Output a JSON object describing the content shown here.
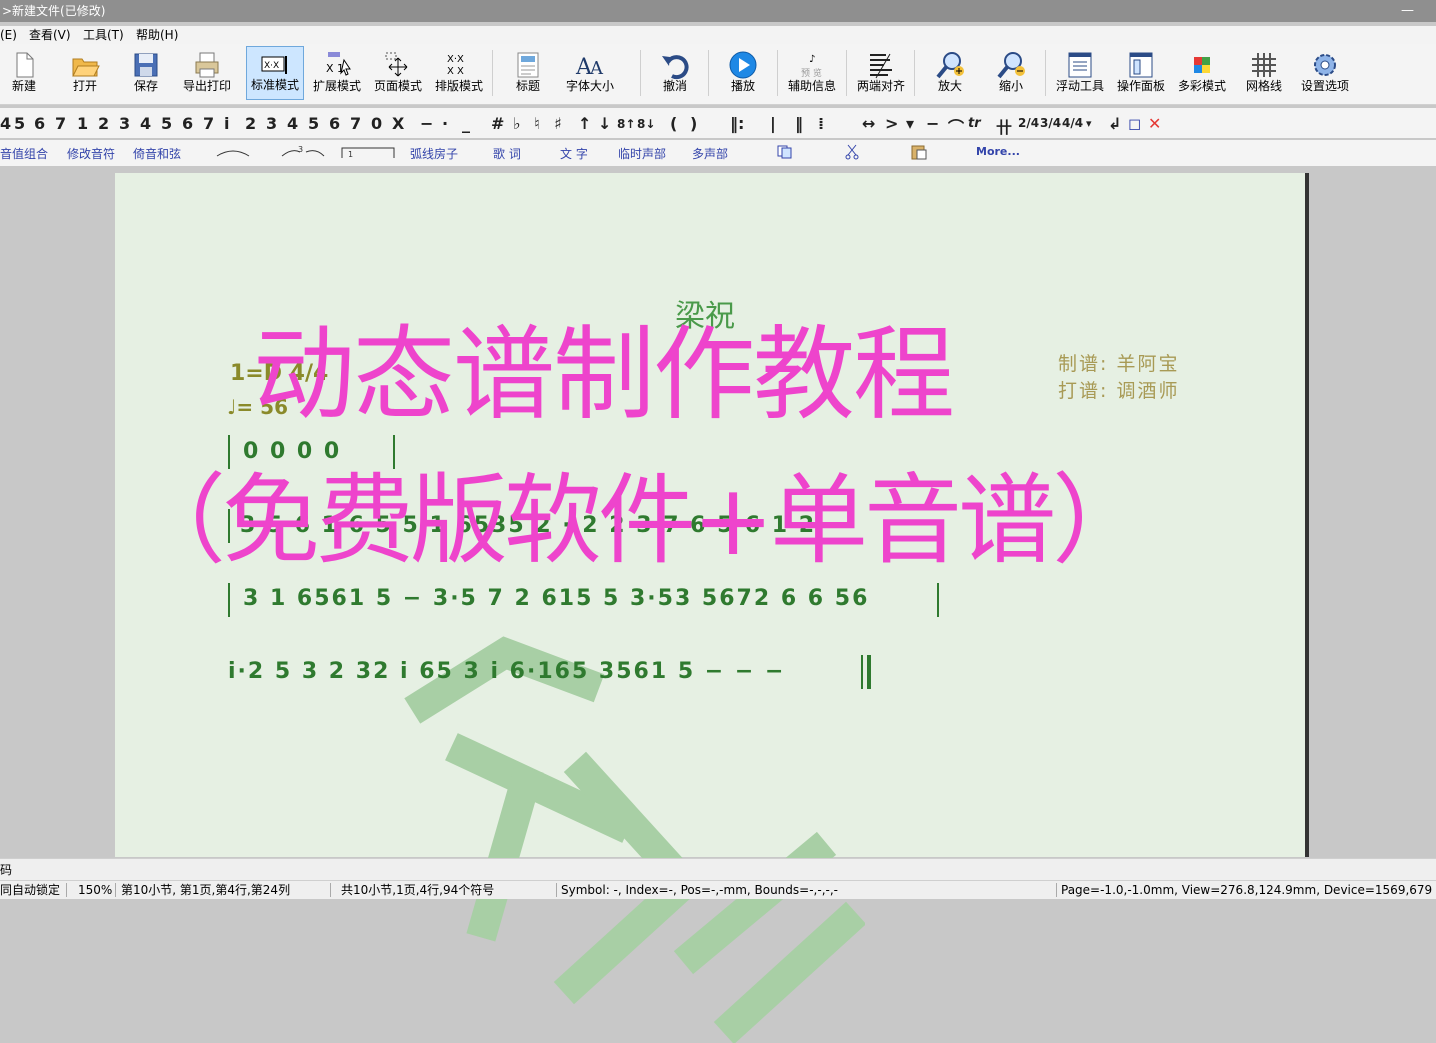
{
  "window": {
    "title": ">新建文件(已修改)",
    "minimize_glyph": "—"
  },
  "menu": [
    "(E)",
    "查看(V)",
    "工具(T)",
    "帮助(H)"
  ],
  "toolbar": [
    {
      "label": "新建",
      "icon": "new-file-icon"
    },
    {
      "label": "打开",
      "icon": "open-folder-icon"
    },
    {
      "label": "保存",
      "icon": "save-icon"
    },
    {
      "label": "导出打印",
      "icon": "print-icon"
    },
    {
      "label": "标准模式",
      "icon": "standard-mode-icon",
      "active": true
    },
    {
      "label": "扩展模式",
      "icon": "extended-mode-icon"
    },
    {
      "label": "页面模式",
      "icon": "page-mode-icon"
    },
    {
      "label": "排版模式",
      "icon": "layout-mode-icon"
    },
    {
      "label": "标题",
      "icon": "title-icon"
    },
    {
      "label": "字体大小",
      "icon": "font-size-icon"
    },
    {
      "label": "撤消",
      "icon": "undo-icon"
    },
    {
      "label": "播放",
      "icon": "play-icon"
    },
    {
      "label": "辅助信息",
      "icon": "aux-info-icon"
    },
    {
      "label": "两端对齐",
      "icon": "justify-icon"
    },
    {
      "label": "放大",
      "icon": "zoom-in-icon"
    },
    {
      "label": "缩小",
      "icon": "zoom-out-icon"
    },
    {
      "label": "浮动工具",
      "icon": "floating-tools-icon"
    },
    {
      "label": "操作面板",
      "icon": "operation-panel-icon"
    },
    {
      "label": "多彩模式",
      "icon": "color-mode-icon"
    },
    {
      "label": "网格线",
      "icon": "grid-icon"
    },
    {
      "label": "设置选项",
      "icon": "settings-gear-icon"
    }
  ],
  "notes_bar": {
    "digits": [
      "4",
      "5",
      "6",
      "7",
      "1",
      "2",
      "3",
      "4",
      "5",
      "6",
      "7",
      "i",
      "2",
      "3",
      "4",
      "5",
      "6",
      "7",
      "0",
      "X"
    ],
    "symbols": [
      "−",
      "·",
      "_",
      "#",
      "♭",
      "♮",
      "♯",
      "↑",
      "↓",
      "8↑",
      "8↓",
      "(",
      ")",
      "‖:",
      "|",
      "‖",
      "⁞",
      "↔",
      ">",
      "▾",
      "−",
      "⌒",
      "tr",
      "卄",
      "2/4",
      "3/4",
      "4/4",
      "▾",
      "↲",
      "◻",
      "✕"
    ]
  },
  "links": [
    "音值组合",
    "修改音符",
    "倚音和弦",
    "弧线房子",
    "歌 词",
    "文 字",
    "临时声部",
    "多声部",
    "More..."
  ],
  "score": {
    "title": "梁祝",
    "credit1": "制谱: 羊阿宝",
    "credit2": "打谱: 调酒师",
    "key": "1=D 4/4",
    "tempo": "♩= 56",
    "row1": "0  0  0  0",
    "row2": "3  5·6 1  6 5  5  1 6535 2 ·  2 2 3 7 6 5·6 1 2",
    "row3": "3 1  6561  5  −   3·5 7 2  615 5   3·53  5672 6   6 56",
    "row4": "i·2  5 3  2 32  i 65   3   i    6·165  3561   5 − − −"
  },
  "overlay": {
    "line1": "动态谱制作教程",
    "line2": "（免费版软件+单音谱）"
  },
  "status": {
    "row1": "码",
    "auto_lock": "同自动锁定",
    "zoom": "150%",
    "position": "第10小节, 第1页,第4行,第24列",
    "summary": "共10小节,1页,4行,94个符号",
    "symbol": "Symbol: -, Index=-, Pos=-,-mm, Bounds=-,-,-,-",
    "page": "Page=-1.0,-1.0mm, View=276.8,124.9mm, Device=1569,679"
  }
}
